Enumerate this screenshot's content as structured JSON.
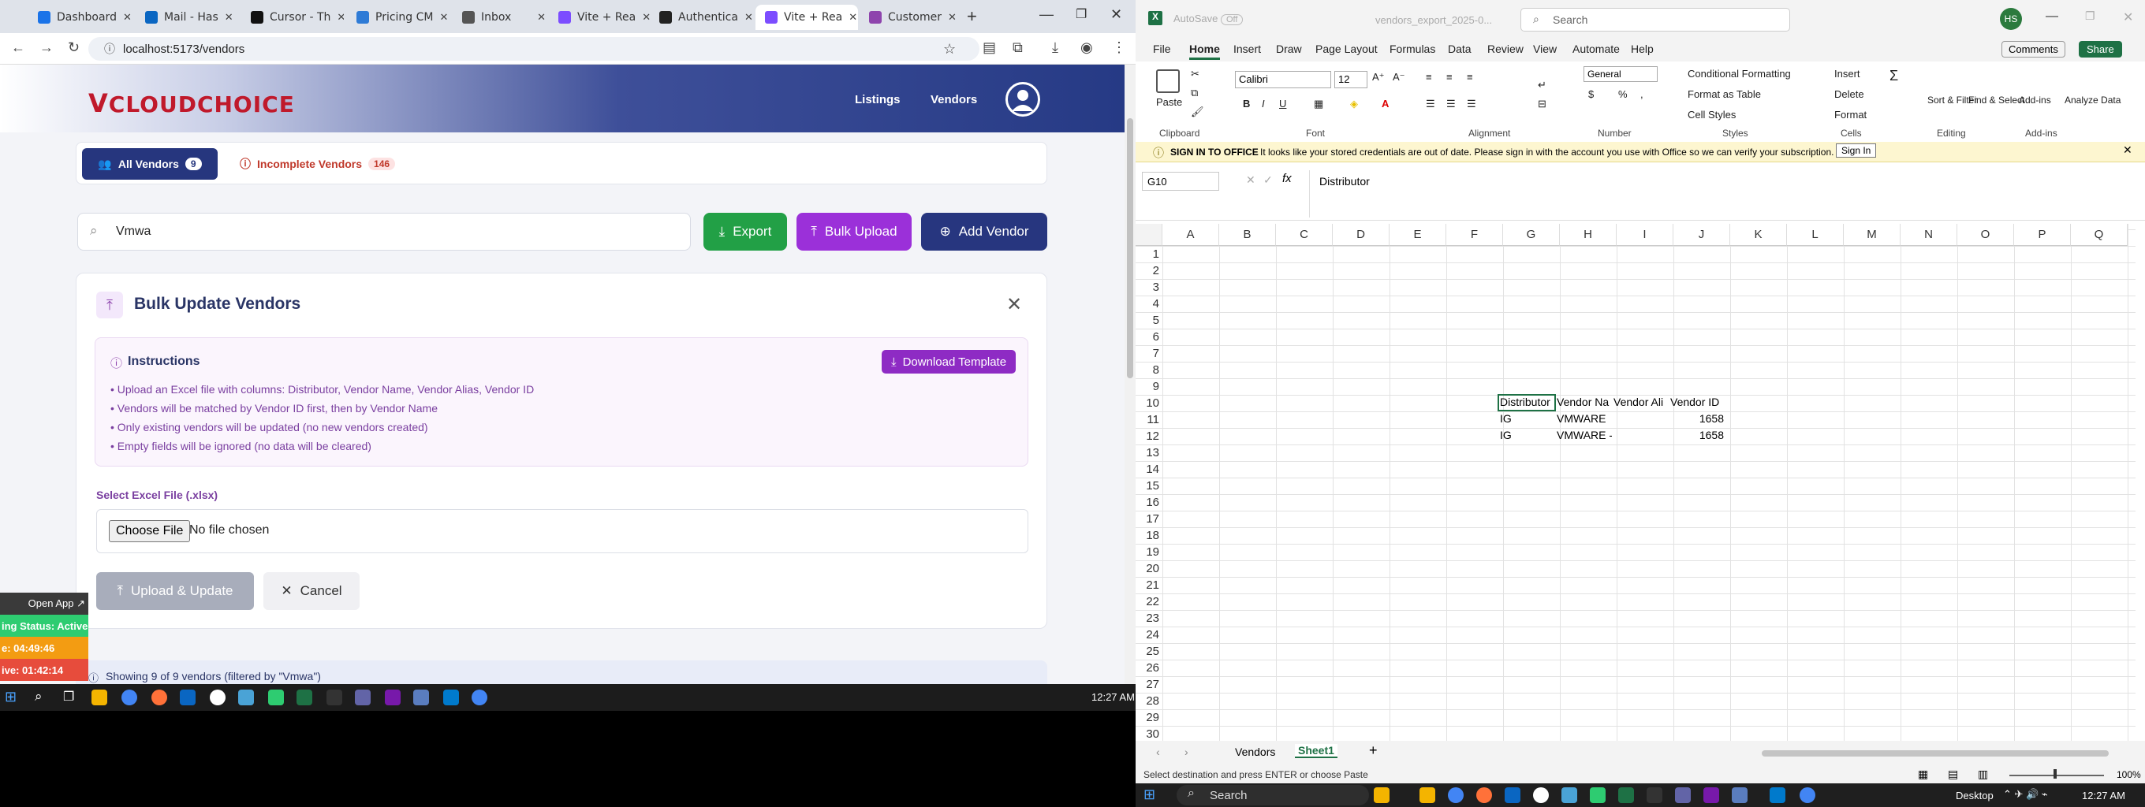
{
  "browser": {
    "tabs": [
      {
        "title": "Dashboard",
        "color": "#1a73e8"
      },
      {
        "title": "Mail - Has",
        "color": "#0a66c2"
      },
      {
        "title": "Cursor - Th",
        "color": "#111111"
      },
      {
        "title": "Pricing CM",
        "color": "#2e7bd6"
      },
      {
        "title": "Inbox",
        "color": "#555555"
      },
      {
        "title": "Vite + Rea",
        "color": "#7c4dff"
      },
      {
        "title": "Authentica",
        "color": "#222222"
      },
      {
        "title": "Vite + Rea",
        "color": "#7c4dff"
      },
      {
        "title": "Customer",
        "color": "#8e44ad"
      }
    ],
    "url": "localhost:5173/vendors"
  },
  "app": {
    "logo_mark": "V",
    "logo_text": "CLOUDCHOICE",
    "nav": [
      "Listings",
      "Vendors"
    ],
    "filters": {
      "all_label": "All Vendors",
      "all_count": "9",
      "incomplete_label": "Incomplete Vendors",
      "incomplete_count": "146"
    },
    "search_value": "Vmwa",
    "buttons": {
      "export": "Export",
      "bulk": "Bulk Upload",
      "add": "Add Vendor"
    },
    "colors": {
      "export": "#22a046",
      "bulk": "#9b30d9",
      "add": "#27367f"
    },
    "bulk": {
      "title": "Bulk Update Vendors",
      "instructions_title": "Instructions",
      "download_template": "Download Template",
      "bullets": [
        "• Upload an Excel file with columns: Distributor, Vendor Name, Vendor Alias, Vendor ID",
        "• Vendors will be matched by Vendor ID first, then by Vendor Name",
        "• Only existing vendors will be updated (no new vendors created)",
        "• Empty fields will be ignored (no data will be cleared)"
      ],
      "select_label": "Select Excel File (.xlsx)",
      "choose_file": "Choose File",
      "no_file": "No file chosen",
      "upload_btn": "Upload & Update",
      "cancel_btn": "Cancel"
    },
    "showing": "Showing 9 of 9 vendors (filtered by \"Vmwa\")"
  },
  "side_panel": {
    "open_app": "Open App ↗",
    "status": "ing Status: Active",
    "time1": "e: 04:49:46",
    "time2": "ive: 01:42:14"
  },
  "taskbar_left": {
    "time": "12:27 AM"
  },
  "excel": {
    "autosave": "AutoSave",
    "autosave_state": "Off",
    "filename": "vendors_export_2025-0...",
    "search": "Search",
    "avatar": "HS",
    "tabs": [
      "File",
      "Home",
      "Insert",
      "Draw",
      "Page Layout",
      "Formulas",
      "Data",
      "Review",
      "View",
      "Automate",
      "Help"
    ],
    "comments": "Comments",
    "share": "Share",
    "groups": [
      "Clipboard",
      "Font",
      "Alignment",
      "Number",
      "Styles",
      "Cells",
      "Editing",
      "Add-ins"
    ],
    "font_name": "Calibri",
    "font_size": "12",
    "number_format": "General",
    "styles": [
      "Conditional Formatting",
      "Format as Table",
      "Cell Styles"
    ],
    "cells": [
      "Insert",
      "Delete",
      "Format"
    ],
    "editing": [
      "Sort & Filter",
      "Find & Select"
    ],
    "addins": [
      "Add-ins",
      "Analyze Data"
    ],
    "paste": "Paste",
    "signin_bar": {
      "title": "SIGN IN TO OFFICE",
      "message": "It looks like your stored credentials are out of date. Please sign in with the account you use with Office so we can verify your subscription.",
      "button": "Sign In"
    },
    "name_box": "G10",
    "formula": "Distributor",
    "columns": [
      "A",
      "B",
      "C",
      "D",
      "E",
      "F",
      "G",
      "H",
      "I",
      "J",
      "K",
      "L",
      "M",
      "N",
      "O",
      "P",
      "Q"
    ],
    "rows": [
      "1",
      "2",
      "3",
      "4",
      "5",
      "6",
      "7",
      "8",
      "9",
      "10",
      "11",
      "12",
      "13",
      "14",
      "15",
      "16",
      "17",
      "18",
      "19",
      "20",
      "21",
      "22",
      "23",
      "24",
      "25",
      "26",
      "27",
      "28",
      "29",
      "30"
    ],
    "cells_data": [
      [
        "Distributor",
        "Vendor Na",
        "Vendor Ali",
        "Vendor ID"
      ],
      [
        "IG",
        "VMWARE",
        "",
        "1658"
      ],
      [
        "IG",
        "VMWARE -",
        "",
        "1658"
      ]
    ],
    "sheets": [
      "Vendors",
      "Sheet1"
    ],
    "status": "Select destination and press ENTER or choose Paste",
    "zoom": "100%"
  },
  "taskbar_right": {
    "search": "Search",
    "desktop": "Desktop",
    "time": "12:27 AM"
  }
}
